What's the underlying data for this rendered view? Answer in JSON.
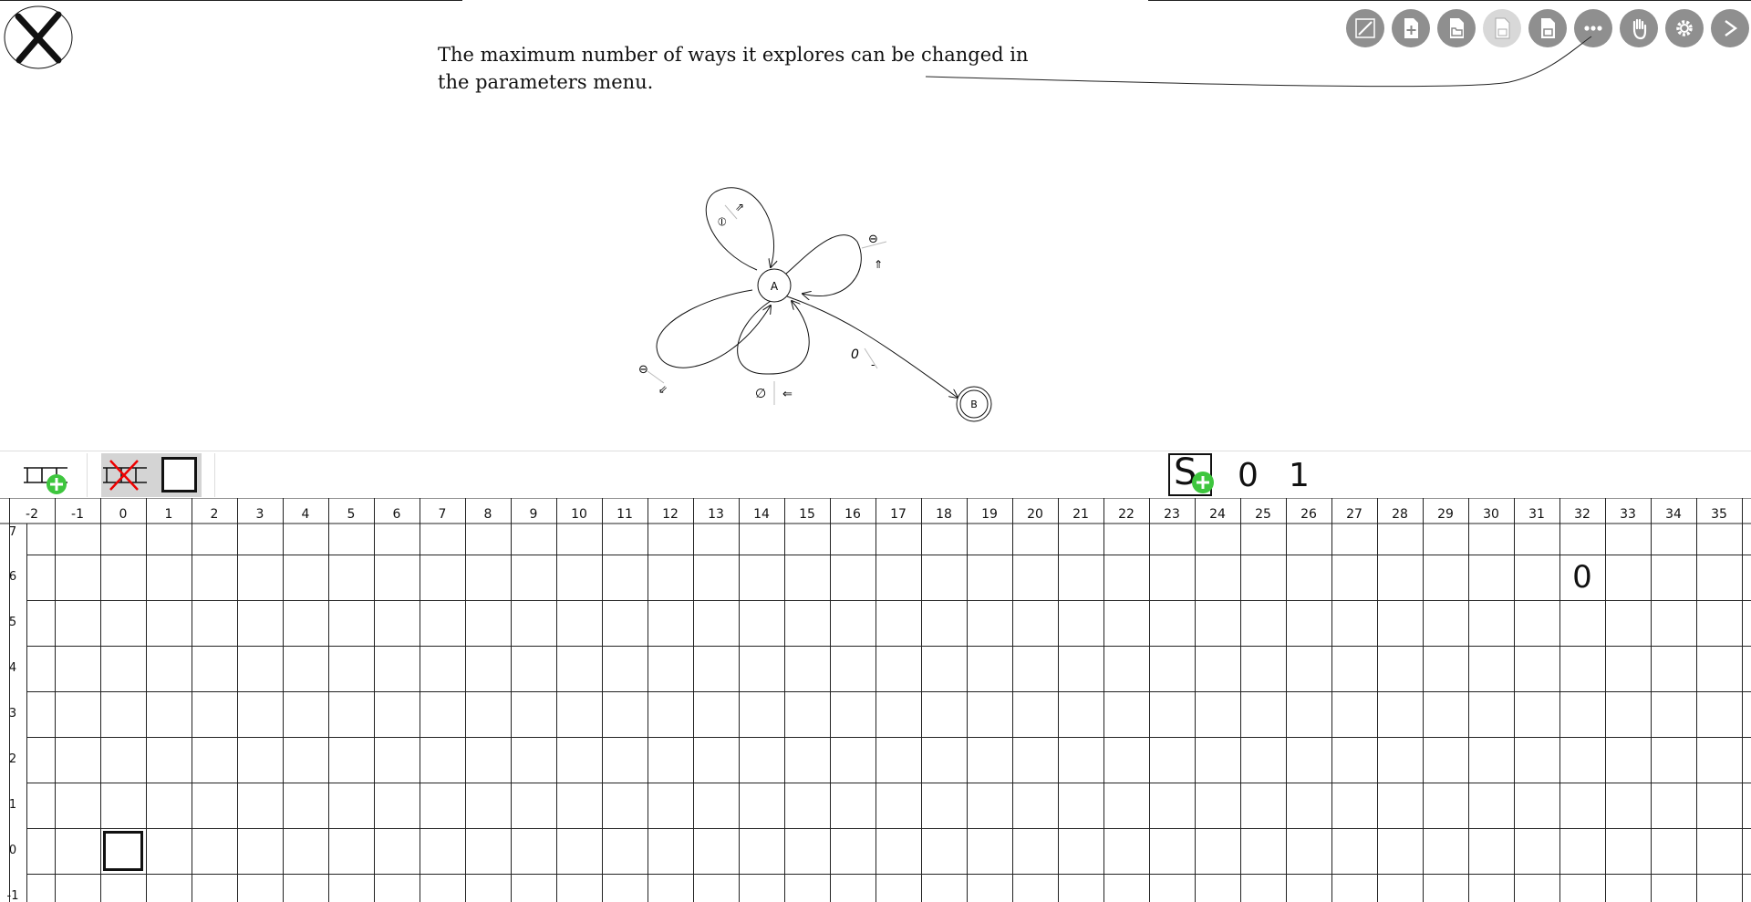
{
  "tooltip": {
    "text": "The maximum number of ways it explores can be changed in the parameters menu."
  },
  "toolbar": {
    "buttons": [
      "draw-icon",
      "new-file-icon",
      "open-folder-icon",
      "save-icon",
      "save-as-icon",
      "more-icon",
      "hand-icon",
      "settings-icon",
      "next-icon"
    ]
  },
  "automaton": {
    "states": [
      {
        "id": "A",
        "label": "A",
        "final": false
      },
      {
        "id": "B",
        "label": "B",
        "final": true
      }
    ],
    "transitions": [
      {
        "from": "A",
        "to": "A",
        "read": "⦶",
        "move": "⇗"
      },
      {
        "from": "A",
        "to": "A",
        "read": "⊖",
        "move": "⇑"
      },
      {
        "from": "A",
        "to": "A",
        "read": "⊖",
        "move": "⇙"
      },
      {
        "from": "A",
        "to": "A",
        "read": "∅",
        "move": "⇐"
      },
      {
        "from": "A",
        "to": "B",
        "read": "0",
        "move": "-"
      }
    ]
  },
  "tape_bar": {
    "symbols": [
      "0",
      "1"
    ],
    "start_symbol": "S"
  },
  "grid": {
    "columns": [
      "-2",
      "-1",
      "0",
      "1",
      "2",
      "3",
      "4",
      "5",
      "6",
      "7",
      "8",
      "9",
      "10",
      "11",
      "12",
      "13",
      "14",
      "15",
      "16",
      "17",
      "18",
      "19",
      "20",
      "21",
      "22",
      "23",
      "24",
      "25",
      "26",
      "27",
      "28",
      "29",
      "30",
      "31",
      "32",
      "33",
      "34",
      "35"
    ],
    "rows": [
      "7",
      "6",
      "5",
      "4",
      "3",
      "2",
      "1",
      "0",
      "-1"
    ],
    "cells": [
      {
        "col": "32",
        "row": "6",
        "value": "0"
      }
    ],
    "head": {
      "col": "0",
      "row": "0"
    }
  }
}
